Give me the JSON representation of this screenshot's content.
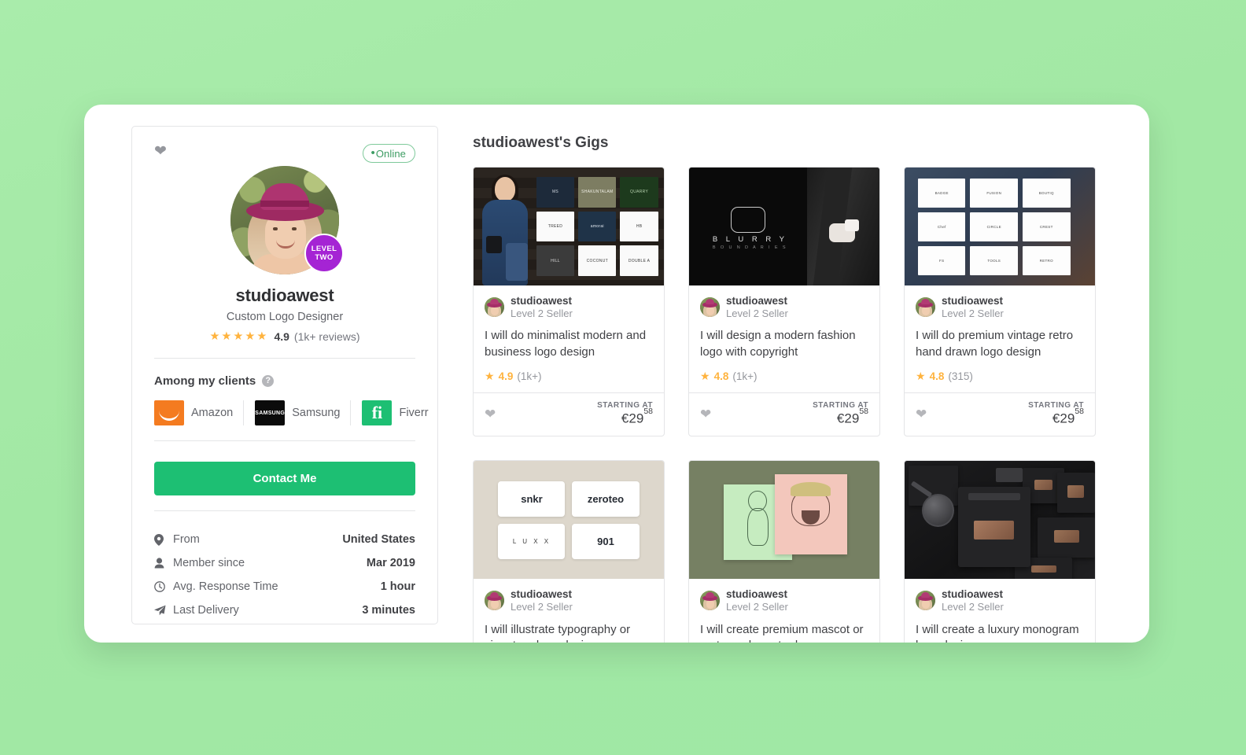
{
  "page": {
    "background_color": "#a4eaa4",
    "card_background": "#ffffff"
  },
  "seller": {
    "favorite_icon": "heart-icon",
    "online_badge": "Online",
    "online_badge_color": "#3d9c63",
    "avatar_alt": "studioawest profile photo",
    "level_badge_line1": "LEVEL",
    "level_badge_line2": "TWO",
    "level_badge_color": "#a524d4",
    "name": "studioawest",
    "role": "Custom Logo Designer",
    "stars": "★★★★★",
    "rating": "4.9",
    "reviews": "(1k+ reviews)",
    "clients_title": "Among my clients",
    "clients_help_icon": "question-mark-icon",
    "clients": [
      {
        "name": "Amazon",
        "logo": "amazon-logo",
        "color": "#f47b20"
      },
      {
        "name": "Samsung",
        "logo": "samsung-logo",
        "color": "#0b0b0b",
        "mark": "SAMSUNG"
      },
      {
        "name": "Fiverr",
        "logo": "fiverr-logo",
        "color": "#1dbf73",
        "mark": "fi"
      }
    ],
    "contact_button": "Contact Me",
    "stats": [
      {
        "icon": "location-pin-icon",
        "glyph": "⬤",
        "label": "From",
        "value": "United States"
      },
      {
        "icon": "person-icon",
        "glyph": "●",
        "label": "Member since",
        "value": "Mar 2019"
      },
      {
        "icon": "clock-icon",
        "glyph": "○",
        "label": "Avg. Response Time",
        "value": "1 hour"
      },
      {
        "icon": "paper-plane-icon",
        "glyph": "➤",
        "label": "Last Delivery",
        "value": "3 minutes"
      }
    ]
  },
  "gigs_section": {
    "title": "studioawest's Gigs",
    "gigs": [
      {
        "seller_name": "studioawest",
        "seller_level": "Level 2 Seller",
        "title": "I will do minimalist modern and business logo design",
        "rating": "4.9",
        "reviews": "(1k+)",
        "starting_at": "STARTING AT",
        "currency": "€",
        "price_whole": "29",
        "price_cents": "58",
        "thumb": "logo-grid-dark-wall-model"
      },
      {
        "seller_name": "studioawest",
        "seller_level": "Level 2 Seller",
        "title": "I will design a modern fashion logo with copyright",
        "rating": "4.8",
        "reviews": "(1k+)",
        "starting_at": "STARTING AT",
        "currency": "€",
        "price_whole": "29",
        "price_cents": "58",
        "thumb": "blurry-boundaries-black",
        "thumb_text": {
          "brand": "B L U R R Y",
          "sub": "B O U N D A R I E S"
        }
      },
      {
        "seller_name": "studioawest",
        "seller_level": "Level 2 Seller",
        "title": "I will do premium vintage retro hand drawn logo design",
        "rating": "4.8",
        "reviews": "(315)",
        "starting_at": "STARTING AT",
        "currency": "€",
        "price_whole": "29",
        "price_cents": "58",
        "thumb": "vintage-badge-grid"
      },
      {
        "seller_name": "studioawest",
        "seller_level": "Level 2 Seller",
        "title": "I will illustrate typography or signature logo design",
        "thumb": "typography-cards-beige",
        "thumb_text": {
          "c1": "snkr",
          "c2": "zeroteo",
          "c3": "L U X X",
          "c4": "901"
        }
      },
      {
        "seller_name": "studioawest",
        "seller_level": "Level 2 Seller",
        "title": "I will create premium mascot or cartoon character logo...",
        "thumb": "mascot-cartoon-olive"
      },
      {
        "seller_name": "studioawest",
        "seller_level": "Level 2 Seller",
        "title": "I will create a luxury monogram logo design",
        "thumb": "dark-monogram-stationery"
      }
    ]
  }
}
